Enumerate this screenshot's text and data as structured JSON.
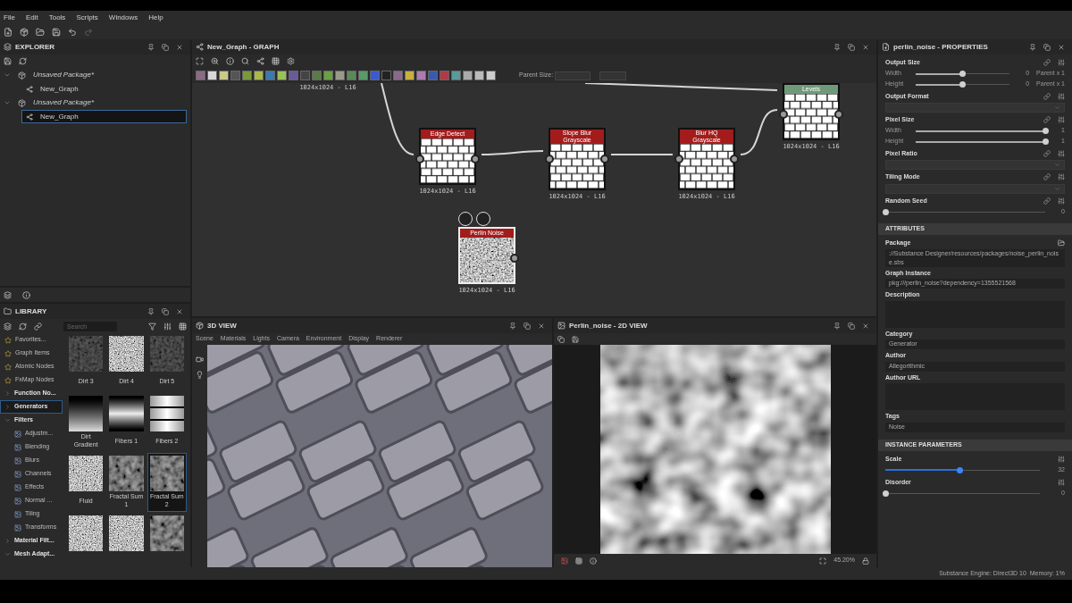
{
  "menu": [
    "File",
    "Edit",
    "Tools",
    "Scripts",
    "Windows",
    "Help"
  ],
  "explorer": {
    "title": "EXPLORER",
    "tree": [
      {
        "label": "Unsaved Package*",
        "expanded": true,
        "children": [
          {
            "label": "New_Graph",
            "selected": false
          }
        ]
      },
      {
        "label": "Unsaved Package*",
        "expanded": true,
        "children": [
          {
            "label": "New_Graph",
            "selected": true
          }
        ]
      }
    ]
  },
  "library": {
    "title": "LIBRARY",
    "search": {
      "placeholder": "Search"
    },
    "categories": [
      {
        "label": "Favorites...",
        "kind": "item",
        "selected": false
      },
      {
        "label": "Graph Items",
        "kind": "item",
        "selected": false
      },
      {
        "label": "Atomic Nodes",
        "kind": "item",
        "selected": false
      },
      {
        "label": "FxMap Nodes",
        "kind": "item",
        "selected": false
      },
      {
        "label": "Function No...",
        "kind": "group",
        "expanded": false,
        "selected": false
      },
      {
        "label": "Generators",
        "kind": "group",
        "expanded": false,
        "selected": true
      },
      {
        "label": "Filters",
        "kind": "group",
        "expanded": true,
        "selected": false,
        "children": [
          {
            "label": "Adjustm...",
            "selected": false
          },
          {
            "label": "Blending",
            "selected": false
          },
          {
            "label": "Blurs",
            "selected": false
          },
          {
            "label": "Channels",
            "selected": false
          },
          {
            "label": "Effects",
            "selected": false
          },
          {
            "label": "Normal ...",
            "selected": false
          },
          {
            "label": "Tiling",
            "selected": false
          },
          {
            "label": "Transforms",
            "selected": false
          }
        ]
      },
      {
        "label": "Material Filt...",
        "kind": "group",
        "expanded": false,
        "selected": false
      },
      {
        "label": "Mesh Adapt...",
        "kind": "group",
        "expanded": true,
        "selected": false
      }
    ],
    "thumbnails": [
      {
        "label": "Dirt 3",
        "kind": "dark",
        "selected": false
      },
      {
        "label": "Dirt 4",
        "kind": "speckle",
        "selected": false
      },
      {
        "label": "Dirt 5",
        "kind": "dark",
        "selected": false
      },
      {
        "label": "Dirt Gradient",
        "kind": "gradient",
        "selected": false
      },
      {
        "label": "Fibers 1",
        "kind": "band",
        "selected": false
      },
      {
        "label": "Fibers 2",
        "kind": "stripes",
        "selected": false
      },
      {
        "label": "Fluid",
        "kind": "speckle",
        "selected": false
      },
      {
        "label": "Fractal Sum 1",
        "kind": "cloud",
        "selected": false
      },
      {
        "label": "Fractal Sum 2",
        "kind": "cloud",
        "selected": true
      },
      {
        "kind": "speckle",
        "selected": false
      },
      {
        "kind": "speckle",
        "selected": false
      },
      {
        "kind": "cloud",
        "selected": false
      }
    ]
  },
  "graph": {
    "title": "New_Graph - GRAPH",
    "parent_size_label": "Parent Size:",
    "nodes": [
      {
        "kind": "partial",
        "size": "1024x1024 - L16"
      },
      {
        "title": "Edge Detect",
        "kind": "bricks",
        "color": "#a31c1c",
        "size": "1024x1024 - L16"
      },
      {
        "title": "Slope Blur Grayscale",
        "kind": "bricks",
        "color": "#a31c1c",
        "size": "1024x1024 - L16"
      },
      {
        "title": "Blur HQ Grayscale",
        "kind": "bricks",
        "color": "#a31c1c",
        "size": "1024x1024 - L16"
      },
      {
        "title": "Levels",
        "kind": "bricks",
        "color": "#6f9a7a",
        "size": "1024x1024 - L16"
      },
      {
        "title": "Perlin Noise",
        "kind": "noise",
        "color": "#a31c1c",
        "size": "1024x1024 - L16",
        "selected": true
      }
    ]
  },
  "view3d": {
    "title": "3D VIEW",
    "menu": [
      "Scene",
      "Materials",
      "Lights",
      "Camera",
      "Environment",
      "Display",
      "Renderer"
    ]
  },
  "view2d": {
    "title": "Perlin_noise - 2D VIEW",
    "zoom": "45.20%"
  },
  "properties": {
    "title": "perlin_noise - PROPERTIES",
    "groups": [
      {
        "label": "Output Size",
        "kind": "sliders",
        "rows": [
          {
            "label": "Width",
            "level": 0.5,
            "value": "0",
            "suffix": "Parent x 1"
          },
          {
            "label": "Height",
            "level": 0.5,
            "value": "0",
            "suffix": "Parent x 1"
          }
        ]
      },
      {
        "label": "Output Format",
        "kind": "dropdown"
      },
      {
        "label": "Pixel Size",
        "kind": "sliders",
        "rows": [
          {
            "label": "Width",
            "level": 1,
            "value": "1"
          },
          {
            "label": "Height",
            "level": 1,
            "value": "1"
          }
        ]
      },
      {
        "label": "Pixel Ratio",
        "kind": "dropdown"
      },
      {
        "label": "Tiling Mode",
        "kind": "dropdown"
      },
      {
        "label": "Random Seed",
        "kind": "sliders",
        "rows": [
          {
            "level": 0,
            "value": "0"
          }
        ]
      }
    ],
    "attributes": {
      "title": "ATTRIBUTES",
      "fields": [
        {
          "label": "Package",
          "value": "://Substance Designer/resources/packages/noise_perlin_noise.sbs",
          "kind": "line"
        },
        {
          "label": "Graph Instance",
          "value": "pkg:///perlin_noise?dependency=1355521568",
          "kind": "line"
        },
        {
          "label": "Description",
          "kind": "area"
        },
        {
          "label": "Category",
          "value": "Generator",
          "kind": "line"
        },
        {
          "label": "Author",
          "value": "Allegorithmic",
          "kind": "line"
        },
        {
          "label": "Author URL",
          "kind": "area"
        },
        {
          "label": "Tags",
          "value": "Noise",
          "kind": "line"
        }
      ]
    },
    "instance": {
      "title": "INSTANCE PARAMETERS",
      "params": [
        {
          "label": "Scale",
          "level": 0.48,
          "value": "32",
          "active": true
        },
        {
          "label": "Disorder",
          "level": 0,
          "value": "0",
          "active": false
        }
      ]
    }
  },
  "status_bar": "Substance Engine: Direct3D 10  Memory: 1%"
}
